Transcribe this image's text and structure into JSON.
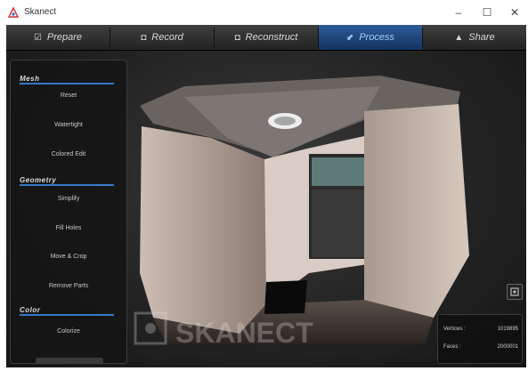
{
  "window": {
    "title": "Skanect",
    "minimize": "–",
    "maximize": "☐",
    "close": "✕"
  },
  "tabs": [
    {
      "label": "Prepare",
      "icon": "☑"
    },
    {
      "label": "Record",
      "icon": "◘"
    },
    {
      "label": "Reconstruct",
      "icon": "◘"
    },
    {
      "label": "Process",
      "icon": "⬋"
    },
    {
      "label": "Share",
      "icon": "▲"
    }
  ],
  "active_tab": "Process",
  "panel": {
    "sections": [
      {
        "title": "Mesh",
        "items": [
          "Reset",
          "Watertight",
          "Colored Edit"
        ]
      },
      {
        "title": "Geometry",
        "items": [
          "Simplify",
          "Fill Holes",
          "Move & Crop",
          "Remove Parts"
        ]
      },
      {
        "title": "Color",
        "items": [
          "Colorize"
        ]
      }
    ]
  },
  "stats": {
    "vertices_label": "Vertices :",
    "vertices_value": "1019895",
    "faces_label": "Faces :",
    "faces_value": "2000001"
  },
  "watermark": "SKANECT",
  "colors": {
    "accent": "#3a78c8",
    "active_tab": "#1f4a85",
    "background": "#1b1b1b"
  }
}
